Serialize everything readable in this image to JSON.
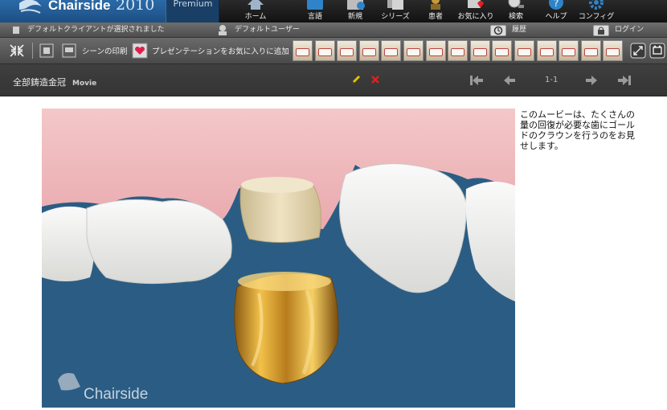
{
  "app": {
    "name": "Chairside",
    "year": "2010",
    "edition": "Premium"
  },
  "nav": [
    {
      "label": "ホーム",
      "icon": "home-icon"
    },
    {
      "label": "言語",
      "icon": "language-icon"
    },
    {
      "label": "新規",
      "icon": "new-icon"
    },
    {
      "label": "シリーズ",
      "icon": "series-icon"
    },
    {
      "label": "患者",
      "icon": "patient-icon"
    },
    {
      "label": "お気に入り",
      "icon": "favorites-icon"
    },
    {
      "label": "検索",
      "icon": "search-icon"
    },
    {
      "label": "ヘルプ",
      "icon": "help-icon"
    },
    {
      "label": "コンフィグ",
      "icon": "config-icon"
    }
  ],
  "status": {
    "client": "デフォルトクライアントが選択されました",
    "user": "デフォルトユーザー",
    "history": "履歴",
    "login": "ログイン"
  },
  "toolbar": {
    "print_scene": "シーンの印刷",
    "add_favorite": "プレゼンテーションをお気に入りに追加",
    "thumb_count": 15
  },
  "title": {
    "text": "全部鋳造金冠",
    "type": "Movie",
    "page": "1-1"
  },
  "content": {
    "watermark": "Chairside",
    "description": "このムービーは、たくさんの量の回復が必要な歯にゴールドのクラウンを行うのをお見せします。"
  },
  "colors": {
    "brand": "#1d4f82",
    "accent_edit": "#e8c400",
    "accent_delete": "#e02020"
  }
}
